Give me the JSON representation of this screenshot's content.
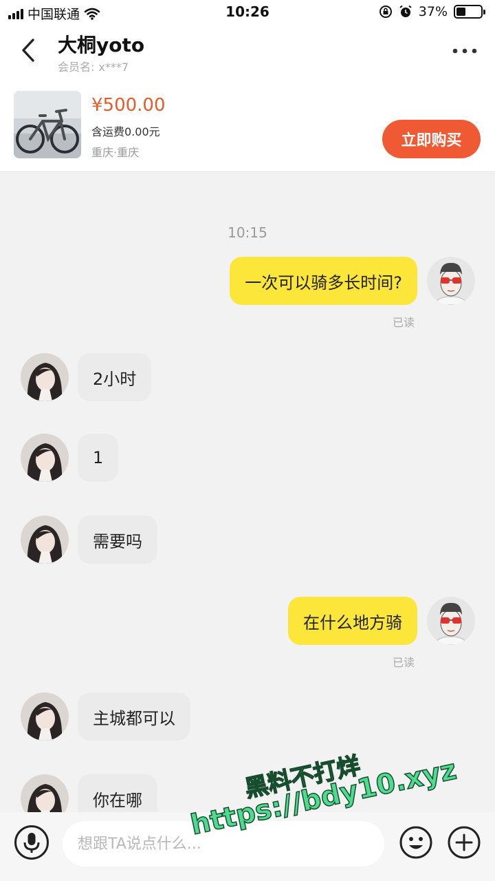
{
  "status_bar": {
    "carrier": "中国联通",
    "time": "10:26",
    "battery_text": "37%",
    "battery_level": 0.37
  },
  "header": {
    "title": "大桐yoto",
    "member_label": "会员名:",
    "member_value": "x***7"
  },
  "product": {
    "price": "¥500.00",
    "shipping": "含运费0.00元",
    "location": "重庆·重庆",
    "buy_label": "立即购买"
  },
  "chat": {
    "time": "10:15",
    "messages": [
      {
        "from": "me",
        "text": "一次可以骑多长时间?",
        "status": "已读"
      },
      {
        "from": "them",
        "text": "2小时"
      },
      {
        "from": "them",
        "text": "1"
      },
      {
        "from": "them",
        "text": "需要吗"
      },
      {
        "from": "me",
        "text": "在什么地方骑",
        "status": "已读"
      },
      {
        "from": "them",
        "text": "主城都可以"
      },
      {
        "from": "them",
        "text": "你在哪"
      }
    ]
  },
  "watermark": {
    "line1": "黑料不打烊",
    "line2": "https://bdy10.xyz"
  },
  "input": {
    "placeholder": "想跟TA说点什么..."
  },
  "colors": {
    "accent": "#ef5a35",
    "price": "#e85a2a",
    "my_bubble": "#fce63a",
    "their_bubble": "#ebebeb"
  }
}
